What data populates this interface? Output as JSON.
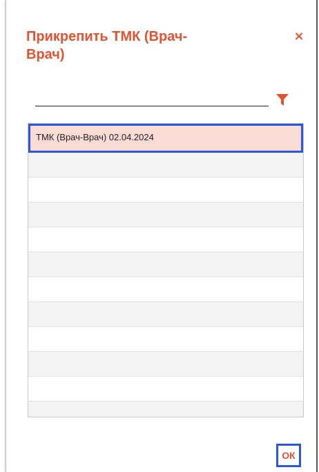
{
  "dialog": {
    "title": "Прикрепить ТМК (Врач-Врач)",
    "close_glyph": "×",
    "close_icon": "close-icon",
    "filter_icon": "filter-icon",
    "accent_color": "#e4532f",
    "focus_color": "#2e57d6"
  },
  "search": {
    "value": "",
    "placeholder": ""
  },
  "list": {
    "items": [
      {
        "label": "ТМК (Врач-Врач) 02.04.2024",
        "selected": true
      }
    ],
    "selected_bg": "#fadbd5"
  },
  "footer": {
    "ok_label": "ОК"
  }
}
